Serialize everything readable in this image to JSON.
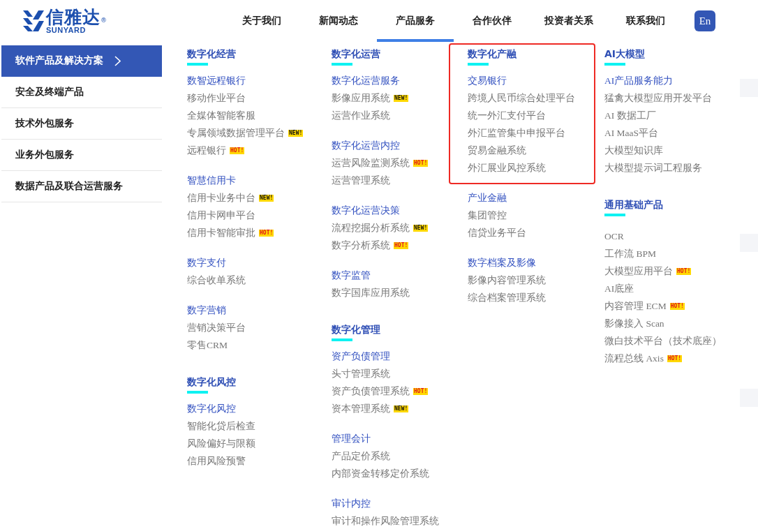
{
  "logo": {
    "name": "信雅达",
    "latin": "SUNYARD",
    "mark": "®"
  },
  "nav": [
    {
      "label": "关于我们",
      "selected": false
    },
    {
      "label": "新闻动态",
      "selected": false
    },
    {
      "label": "产品服务",
      "selected": true
    },
    {
      "label": "合作伙伴",
      "selected": false
    },
    {
      "label": "投资者关系",
      "selected": false
    },
    {
      "label": "联系我们",
      "selected": false
    }
  ],
  "language_button": "En",
  "sidebar": {
    "items": [
      {
        "label": "软件产品及解决方案",
        "selected": true
      },
      {
        "label": "安全及终端产品",
        "selected": false
      },
      {
        "label": "技术外包服务",
        "selected": false
      },
      {
        "label": "业务外包服务",
        "selected": false
      },
      {
        "label": "数据产品及联合运营服务",
        "selected": false
      }
    ]
  },
  "columns": [
    {
      "sections": [
        {
          "title": "数字化经营",
          "highlighted": false,
          "groups": [
            {
              "heading": "数智远程银行",
              "items": [
                {
                  "label": "移动作业平台"
                },
                {
                  "label": "全媒体智能客服"
                },
                {
                  "label": "专属领域数据管理平台",
                  "badge": {
                    "kind": "new",
                    "text": "NEW!"
                  }
                },
                {
                  "label": "远程银行",
                  "badge": {
                    "kind": "hot",
                    "text": "HOT!"
                  }
                }
              ]
            },
            {
              "heading": "智慧信用卡",
              "items": [
                {
                  "label": "信用卡业务中台",
                  "badge": {
                    "kind": "new",
                    "text": "NEW!"
                  }
                },
                {
                  "label": "信用卡网申平台"
                },
                {
                  "label": "信用卡智能审批",
                  "badge": {
                    "kind": "hot",
                    "text": "HOT!"
                  }
                }
              ]
            },
            {
              "heading": "数字支付",
              "items": [
                {
                  "label": "综合收单系统"
                }
              ]
            },
            {
              "heading": "数字营销",
              "items": [
                {
                  "label": "营销决策平台"
                },
                {
                  "label": "零售CRM"
                }
              ]
            }
          ]
        },
        {
          "title": "数字化风控",
          "highlighted": false,
          "groups": [
            {
              "heading": "数字化风控",
              "items": [
                {
                  "label": "智能化贷后检查"
                },
                {
                  "label": "风险偏好与限额"
                },
                {
                  "label": "信用风险预警"
                }
              ]
            }
          ]
        }
      ]
    },
    {
      "sections": [
        {
          "title": "数字化运营",
          "highlighted": false,
          "groups": [
            {
              "heading": "数字化运营服务",
              "items": [
                {
                  "label": "影像应用系统",
                  "badge": {
                    "kind": "new",
                    "text": "NEW!"
                  }
                },
                {
                  "label": "运营作业系统"
                }
              ]
            },
            {
              "heading": "数字化运营内控",
              "items": [
                {
                  "label": "运营风险监测系统",
                  "badge": {
                    "kind": "hot",
                    "text": "HOT!"
                  }
                },
                {
                  "label": "运营管理系统"
                }
              ]
            },
            {
              "heading": "数字化运营决策",
              "items": [
                {
                  "label": "流程挖掘分析系统",
                  "badge": {
                    "kind": "new",
                    "text": "NEW!"
                  }
                },
                {
                  "label": "数字分析系统",
                  "badge": {
                    "kind": "hot",
                    "text": "HOT!"
                  }
                }
              ]
            },
            {
              "heading": "数字监管",
              "items": [
                {
                  "label": "数字国库应用系统"
                }
              ]
            }
          ]
        },
        {
          "title": "数字化管理",
          "highlighted": false,
          "groups": [
            {
              "heading": "资产负债管理",
              "items": [
                {
                  "label": "头寸管理系统"
                },
                {
                  "label": "资产负债管理系统",
                  "badge": {
                    "kind": "hot",
                    "text": "HOT!"
                  }
                },
                {
                  "label": "资本管理系统",
                  "badge": {
                    "kind": "new",
                    "text": "NEW!"
                  }
                }
              ]
            },
            {
              "heading": "管理会计",
              "items": [
                {
                  "label": "产品定价系统"
                },
                {
                  "label": "内部资金转移定价系统"
                }
              ]
            },
            {
              "heading": "审计内控",
              "items": [
                {
                  "label": "审计和操作风险管理系统"
                }
              ]
            }
          ]
        }
      ]
    },
    {
      "sections": [
        {
          "title": "数字化产融",
          "highlighted": true,
          "groups": [
            {
              "heading": "交易银行",
              "items": [
                {
                  "label": "跨境人民币综合处理平台"
                },
                {
                  "label": "统一外汇支付平台"
                },
                {
                  "label": "外汇监管集中申报平台"
                },
                {
                  "label": "贸易金融系统"
                },
                {
                  "label": "外汇展业风控系统"
                }
              ]
            }
          ]
        },
        {
          "highlighted": false,
          "groups": [
            {
              "heading": "产业金融",
              "items": [
                {
                  "label": "集团管控"
                },
                {
                  "label": "信贷业务平台"
                }
              ]
            },
            {
              "heading": "数字档案及影像",
              "items": [
                {
                  "label": "影像内容管理系统"
                },
                {
                  "label": "综合档案管理系统"
                }
              ]
            }
          ]
        }
      ]
    },
    {
      "sections": [
        {
          "title": "AI大模型",
          "highlighted": false,
          "groups": [
            {
              "heading": "AI产品服务能力",
              "items": [
                {
                  "label": "猛禽大模型应用开发平台"
                },
                {
                  "label": "AI 数据工厂"
                },
                {
                  "label": "AI MaaS平台"
                },
                {
                  "label": "大模型知识库"
                },
                {
                  "label": "大模型提示词工程服务"
                }
              ]
            }
          ]
        },
        {
          "title": "通用基础产品",
          "highlighted": false,
          "groups": [
            {
              "items": [
                {
                  "label": "OCR"
                },
                {
                  "label": "工作流 BPM"
                },
                {
                  "label": "大模型应用平台",
                  "badge": {
                    "kind": "hot",
                    "text": "HOT!"
                  }
                },
                {
                  "label": "AI底座"
                },
                {
                  "label": "内容管理 ECM",
                  "badge": {
                    "kind": "hot",
                    "text": "HOT!"
                  }
                },
                {
                  "label": "影像接入 Scan"
                },
                {
                  "label": "微白技术平台（技术底座）"
                },
                {
                  "label": "流程总线 Axis",
                  "badge": {
                    "kind": "hot",
                    "text": "HOT!"
                  }
                }
              ]
            }
          ]
        }
      ]
    }
  ]
}
